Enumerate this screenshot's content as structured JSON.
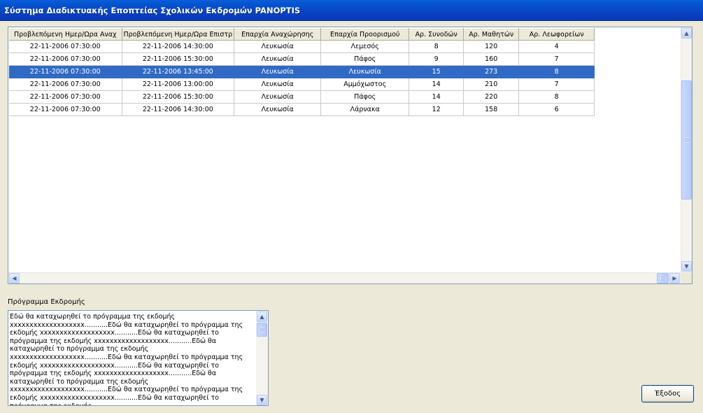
{
  "window": {
    "title": "Σύστημα Διαδικτυακής Εποπτείας Σχολικών Εκδρομών PANOPTIS"
  },
  "grid": {
    "columns": [
      "Προβλεπόμενη Ημερ/Ωρα Αναχ",
      "Προβλεπόμενη Ημερ/Ωρα Επιστρ",
      "Επαρχία Αναχώρησης",
      "Επαρχία Προορισμού",
      "Αρ. Συνοδών",
      "Αρ. Μαθητών",
      "Αρ. Λεωφορείων"
    ],
    "selected_row": 2,
    "rows": [
      [
        "22-11-2006 07:30:00",
        "22-11-2006 14:30:00",
        "Λευκωσία",
        "Λεμεσός",
        "8",
        "120",
        "4"
      ],
      [
        "22-11-2006 07:30:00",
        "22-11-2006 15:30:00",
        "Λευκωσία",
        "Πάφος",
        "9",
        "160",
        "7"
      ],
      [
        "22-11-2006 07:30:00",
        "22-11-2006 13:45:00",
        "Λευκωσία",
        "Λευκωσία",
        "15",
        "273",
        "8"
      ],
      [
        "22-11-2006 07:30:00",
        "22-11-2006 13:00:00",
        "Λευκωσία",
        "Αμμόχωστος",
        "14",
        "210",
        "7"
      ],
      [
        "22-11-2006 07:30:00",
        "22-11-2006 15:30:00",
        "Λευκωσία",
        "Πάφος",
        "14",
        "220",
        "8"
      ],
      [
        "22-11-2006 07:30:00",
        "22-11-2006 14:30:00",
        "Λευκωσία",
        "Λάρνακα",
        "12",
        "158",
        "6"
      ]
    ]
  },
  "program": {
    "label": "Πρόγραμμα Εκδρομής",
    "text": "Εδώ θα καταχωρηθεί το πρόγραμμα της εκδομής xxxxxxxxxxxxxxxxxxx...........Εδώ θα καταχωρηθεί το πρόγραμμα της εκδομής xxxxxxxxxxxxxxxxxxx...........Εδώ θα καταχωρηθεί το πρόγραμμα της εκδομής xxxxxxxxxxxxxxxxxxx...........Εδώ θα καταχωρηθεί το πρόγραμμα της εκδομής xxxxxxxxxxxxxxxxxxx...........Εδώ θα καταχωρηθεί το πρόγραμμα της εκδομής xxxxxxxxxxxxxxxxxxx...........Εδώ θα καταχωρηθεί το πρόγραμμα της εκδομής xxxxxxxxxxxxxxxxxxx...........Εδώ θα καταχωρηθεί το πρόγραμμα της εκδομής xxxxxxxxxxxxxxxxxxx...........Εδώ θα καταχωρηθεί το πρόγραμμα της εκδομής xxxxxxxxxxxxxxxxxxx...........Εδώ θα καταχωρηθεί το πρόγραμμα της εκδομής"
  },
  "buttons": {
    "exit_label": "Έξοδος"
  },
  "icons": {
    "scroll_up": "scroll-up-arrow",
    "scroll_down": "scroll-down-arrow",
    "scroll_left": "scroll-left-arrow",
    "scroll_right": "scroll-right-arrow"
  },
  "colors": {
    "titlebar": "#0a4fd0",
    "selection": "#316ac5",
    "window_bg": "#ece9d8"
  }
}
